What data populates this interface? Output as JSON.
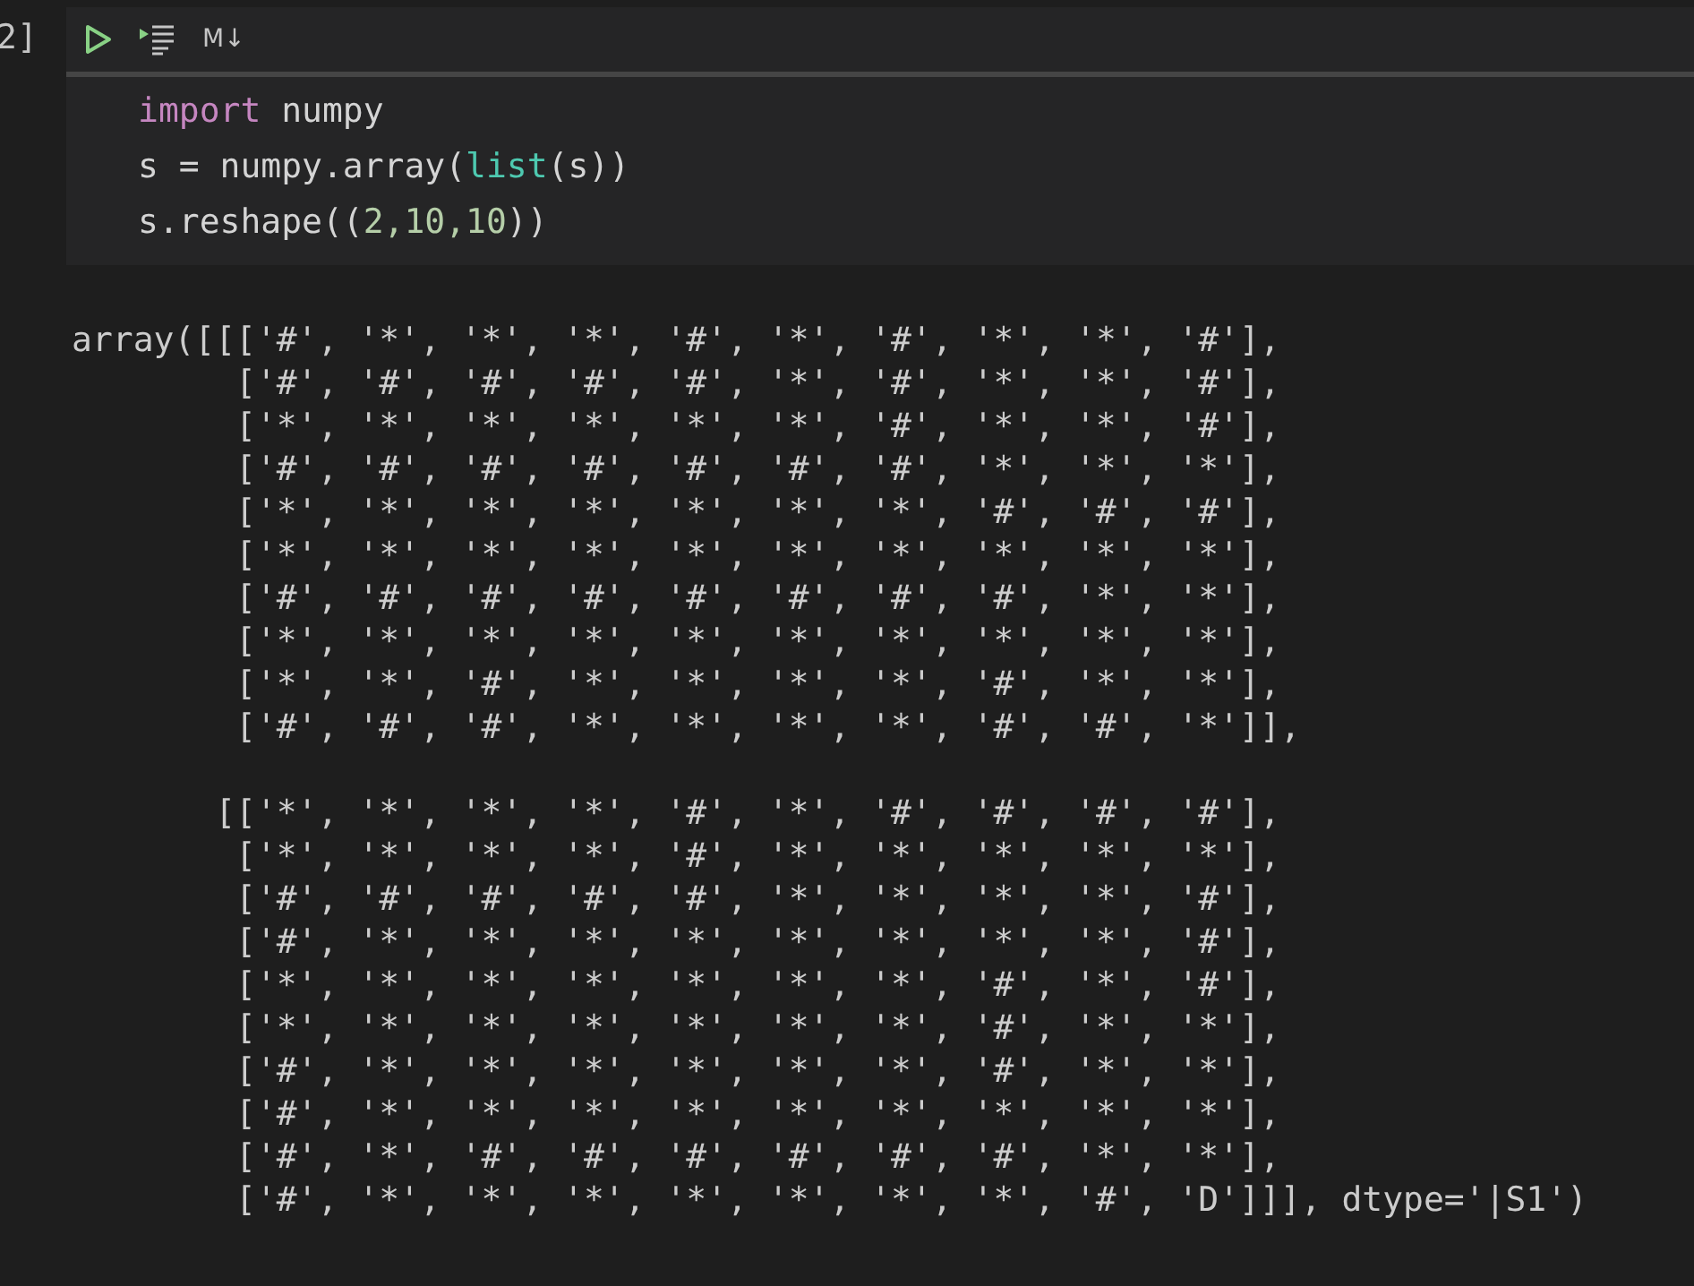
{
  "cell": {
    "execution_count": "2]",
    "toolbar": {
      "markdown_label": "M↓"
    },
    "code_lines": [
      [
        {
          "text": "import",
          "kind": "keyword"
        },
        {
          "text": " numpy",
          "kind": "plain"
        }
      ],
      [
        {
          "text": "s = numpy.array(",
          "kind": "plain"
        },
        {
          "text": "list",
          "kind": "builtin"
        },
        {
          "text": "(s))",
          "kind": "plain"
        }
      ],
      [
        {
          "text": "s.reshape((",
          "kind": "plain"
        },
        {
          "text": "2,10,10",
          "kind": "number"
        },
        {
          "text": "))",
          "kind": "plain"
        }
      ]
    ]
  },
  "output_lines": [
    {
      "kind": "open",
      "text": "array([[['#', '*', '*', '*', '#', '*', '#', '*', '*', '#'],"
    },
    {
      "kind": "row",
      "text": "['#', '#', '#', '#', '#', '*', '#', '*', '*', '#'],"
    },
    {
      "kind": "row",
      "text": "['*', '*', '*', '*', '*', '*', '#', '*', '*', '#'],"
    },
    {
      "kind": "row",
      "text": "['#', '#', '#', '#', '#', '#', '#', '*', '*', '*'],"
    },
    {
      "kind": "row",
      "text": "['*', '*', '*', '*', '*', '*', '*', '#', '#', '#'],"
    },
    {
      "kind": "row",
      "text": "['*', '*', '*', '*', '*', '*', '*', '*', '*', '*'],"
    },
    {
      "kind": "row",
      "text": "['#', '#', '#', '#', '#', '#', '#', '#', '*', '*'],"
    },
    {
      "kind": "row",
      "text": "['*', '*', '*', '*', '*', '*', '*', '*', '*', '*'],"
    },
    {
      "kind": "row",
      "text": "['*', '*', '#', '*', '*', '*', '*', '#', '*', '*'],"
    },
    {
      "kind": "row",
      "text": "['#', '#', '#', '*', '*', '*', '*', '#', '#', '*']],"
    },
    {
      "kind": "block",
      "text": "[['*', '*', '*', '*', '#', '*', '#', '#', '#', '#'],"
    },
    {
      "kind": "row",
      "text": "['*', '*', '*', '*', '#', '*', '*', '*', '*', '*'],"
    },
    {
      "kind": "row",
      "text": "['#', '#', '#', '#', '#', '*', '*', '*', '*', '#'],"
    },
    {
      "kind": "row",
      "text": "['#', '*', '*', '*', '*', '*', '*', '*', '*', '#'],"
    },
    {
      "kind": "row",
      "text": "['*', '*', '*', '*', '*', '*', '*', '#', '*', '#'],"
    },
    {
      "kind": "row",
      "text": "['*', '*', '*', '*', '*', '*', '*', '#', '*', '*'],"
    },
    {
      "kind": "row",
      "text": "['#', '*', '*', '*', '*', '*', '*', '#', '*', '*'],"
    },
    {
      "kind": "row",
      "text": "['#', '*', '*', '*', '*', '*', '*', '*', '*', '*'],"
    },
    {
      "kind": "row",
      "text": "['#', '*', '#', '#', '#', '#', '#', '#', '*', '*'],"
    },
    {
      "kind": "row",
      "text": "['#', '*', '*', '*', '*', '*', '*', '*', '#', 'D']]], dtype='|S1')"
    }
  ]
}
